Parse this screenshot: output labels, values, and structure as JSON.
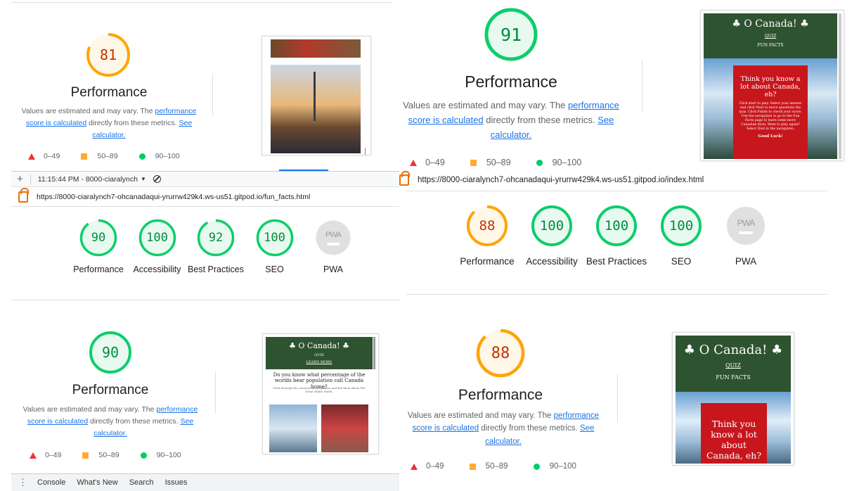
{
  "panels": {
    "top_left": {
      "score": 81,
      "title": "Performance"
    },
    "top_right": {
      "score": 91,
      "title": "Performance"
    },
    "bottom_left": {
      "score": 90,
      "title": "Performance"
    },
    "bottom_right": {
      "score": 88,
      "title": "Performance"
    }
  },
  "description": {
    "prefix": "Values are estimated and may vary. The",
    "link1": "performance score is calculated",
    "middle": "directly from these metrics.",
    "link2": "See calculator."
  },
  "legend": {
    "fail": "0–49",
    "average": "50–89",
    "pass": "90–100"
  },
  "devtools_bar": {
    "add": "+",
    "timestamp": "11:15:44 PM - 8000-ciaralynch",
    "tabs": [
      "Console",
      "What's New",
      "Search",
      "Issues"
    ]
  },
  "urls": {
    "fun_facts": "https://8000-ciaralynch7-ohcanadaqui-yrurrw429k4.ws-us51.gitpod.io/fun_facts.html",
    "index": "https://8000-ciaralynch7-ohcanadaqui-yrurrw429k4.ws-us51.gitpod.io/index.html"
  },
  "gauges_left": [
    {
      "score": "90",
      "label": "Performance",
      "status": "pass"
    },
    {
      "score": "100",
      "label": "Accessibility",
      "status": "pass"
    },
    {
      "score": "92",
      "label": "Best Practices",
      "status": "pass"
    },
    {
      "score": "100",
      "label": "SEO",
      "status": "pass"
    },
    {
      "score": "PWA",
      "label": "PWA",
      "status": "na"
    }
  ],
  "gauges_right": [
    {
      "score": "88",
      "label": "Performance",
      "status": "average"
    },
    {
      "score": "100",
      "label": "Accessibility",
      "status": "pass"
    },
    {
      "score": "100",
      "label": "Best Practices",
      "status": "pass"
    },
    {
      "score": "100",
      "label": "SEO",
      "status": "pass"
    },
    {
      "score": "PWA",
      "label": "PWA",
      "status": "na"
    }
  ],
  "site": {
    "title": "♣ O Canada! ♣",
    "nav_quiz": "QUIZ",
    "nav_fun_facts": "FUN FACTS",
    "nav_learn_more": "LEARN MORE",
    "card_heading": "Think you know a lot about Canada, eh?",
    "card_heading_large": "Think you know a lot about Canada, eh?",
    "card_body": "Click start to play. Select your answer and click Next to move questions the quiz. Click Finish to check your score. Use the navigation to go to the Fun Facts page to learn some more Canadian facts. Want to play again? Select Quiz in the navigation.",
    "card_sign": "Good Luck!",
    "bear_question": "Do you know what percentage of the worlds bear population call Canada home?",
    "bear_sub": "Click through the carousel to see photos and fun facts about The Great White North."
  },
  "colors": {
    "pass": "#0cce6b",
    "average": "#ffa400",
    "fail": "#ff4e42",
    "na": "#9e9e9e",
    "link": "#1a73e8",
    "site_green": "#2e5330",
    "site_red": "#c8161d"
  }
}
